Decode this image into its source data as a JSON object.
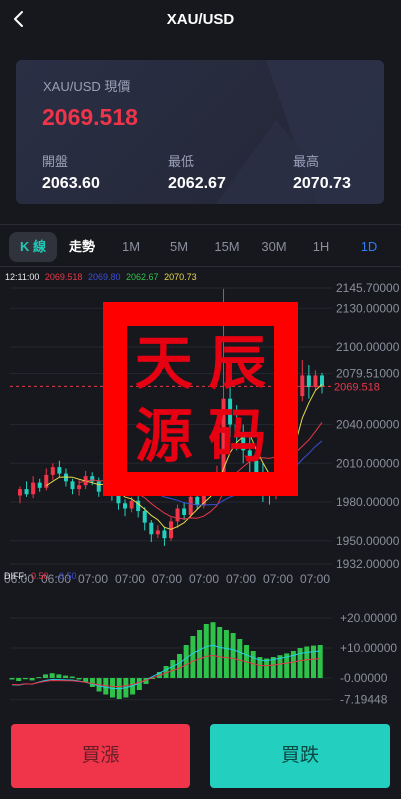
{
  "header": {
    "title": "XAU/USD",
    "back_icon": "chevron-left-icon"
  },
  "card": {
    "label": "XAU/USD 現價",
    "price": "2069.518",
    "open_label": "開盤",
    "open_value": "2063.60",
    "low_label": "最低",
    "low_value": "2062.67",
    "high_label": "最高",
    "high_value": "2070.73"
  },
  "tabs": [
    "K 線",
    "走勢",
    "1M",
    "5M",
    "15M",
    "30M",
    "1H",
    "1D"
  ],
  "legend": {
    "time": "12:11:00",
    "items": [
      {
        "text": "2069.518",
        "color": "#e8364a"
      },
      {
        "text": "2069.80",
        "color": "#3a4fd6"
      },
      {
        "text": "2062.67",
        "color": "#2ec24a"
      },
      {
        "text": "2070.73",
        "color": "#e6d84a"
      }
    ]
  },
  "y_axis": [
    "2145.70000",
    "2130.00000",
    "2100.00000",
    "2079.51000",
    "2040.00000",
    "2010.00000",
    "1980.00000",
    "1950.00000",
    "1932.00000"
  ],
  "current_price_label": "2069.518",
  "x_axis": [
    "06:00",
    "06:00",
    "07:00",
    "07:00",
    "07:00",
    "07:00",
    "07:00",
    "07:00",
    "07:00"
  ],
  "diff": {
    "label": "DIFF:",
    "value": "0.50",
    "value2": "-0.50"
  },
  "macd_axis": [
    "+20.00000",
    "+10.00000",
    "-0.00000",
    "-7.19448"
  ],
  "stamp": {
    "chars": [
      "天",
      "辰",
      "源",
      "码"
    ]
  },
  "buttons": {
    "buy": "買漲",
    "sell": "買跌"
  },
  "colors": {
    "up": "#f0354a",
    "down": "#23d0bf",
    "accent": "#2f7cf6"
  },
  "chart_data": {
    "type": "candlestick",
    "ylim": [
      1932,
      2145.7
    ],
    "candles": [
      [
        1985,
        1990,
        1979,
        1992
      ],
      [
        1990,
        1986,
        1984,
        1996
      ],
      [
        1986,
        1995,
        1983,
        2000
      ],
      [
        1995,
        1991,
        1988,
        1998
      ],
      [
        1991,
        2001,
        1989,
        2006
      ],
      [
        2001,
        2007,
        1997,
        2010
      ],
      [
        2007,
        2002,
        1999,
        2012
      ],
      [
        2002,
        1996,
        1992,
        2006
      ],
      [
        1996,
        1990,
        1986,
        1998
      ],
      [
        1990,
        1993,
        1985,
        1997
      ],
      [
        1993,
        2000,
        1990,
        2004
      ],
      [
        2000,
        1996,
        1993,
        2003
      ],
      [
        1996,
        1988,
        1984,
        1999
      ],
      [
        1988,
        1992,
        1986,
        1996
      ],
      [
        1992,
        1985,
        1981,
        1994
      ],
      [
        1985,
        1979,
        1974,
        1987
      ],
      [
        1979,
        1975,
        1969,
        1982
      ],
      [
        1975,
        1981,
        1972,
        1984
      ],
      [
        1981,
        1973,
        1968,
        1985
      ],
      [
        1973,
        1964,
        1958,
        1976
      ],
      [
        1964,
        1955,
        1949,
        1966
      ],
      [
        1955,
        1958,
        1952,
        1962
      ],
      [
        1958,
        1952,
        1946,
        1961
      ],
      [
        1952,
        1965,
        1950,
        1968
      ],
      [
        1965,
        1975,
        1960,
        1978
      ],
      [
        1975,
        1970,
        1966,
        1980
      ],
      [
        1970,
        1984,
        1968,
        1988
      ],
      [
        1984,
        1978,
        1974,
        1990
      ],
      [
        1978,
        1990,
        1975,
        1995
      ],
      [
        1990,
        1998,
        1986,
        2002
      ],
      [
        1998,
        2003,
        1994,
        2008
      ],
      [
        2003,
        2060,
        2000,
        2145
      ],
      [
        2060,
        2040,
        2030,
        2075
      ],
      [
        2040,
        2030,
        2020,
        2055
      ],
      [
        2030,
        2020,
        2010,
        2040
      ],
      [
        2020,
        2012,
        2000,
        2030
      ],
      [
        2012,
        2000,
        1990,
        2020
      ],
      [
        2000,
        1990,
        1980,
        2010
      ],
      [
        1990,
        1985,
        1978,
        2000
      ],
      [
        1985,
        2010,
        1982,
        2020
      ],
      [
        2010,
        2030,
        2005,
        2040
      ],
      [
        2030,
        2045,
        2025,
        2055
      ],
      [
        2045,
        2062,
        2040,
        2070
      ],
      [
        2062,
        2078,
        2058,
        2090
      ],
      [
        2078,
        2069,
        2060,
        2086
      ],
      [
        2069,
        2078,
        2066,
        2082
      ],
      [
        2078,
        2069,
        2064,
        2080
      ]
    ],
    "macd": [
      -0.5,
      -1,
      -0.4,
      -0.8,
      0.3,
      1.2,
      1.6,
      1.2,
      0.8,
      0.5,
      -0.5,
      -1.5,
      -3,
      -4.5,
      -5.5,
      -6.5,
      -7,
      -6.5,
      -5.5,
      -4,
      -2,
      0,
      2,
      4,
      6,
      8,
      11,
      14,
      16,
      18,
      18.6,
      17,
      16,
      15,
      13,
      11,
      9,
      7,
      6.5,
      7,
      7.6,
      8.2,
      9,
      10,
      10.5,
      10.8,
      11
    ]
  }
}
